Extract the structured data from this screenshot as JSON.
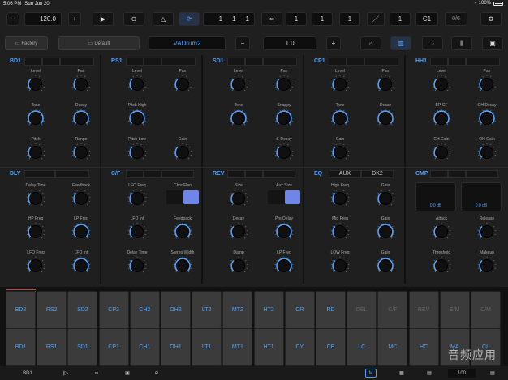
{
  "status": {
    "time": "5:06 PM",
    "date": "Sun Jun 20",
    "battery": "100%"
  },
  "toolbar": {
    "tempo": "120.0",
    "position": [
      "1",
      "1",
      "1"
    ],
    "loop_values": [
      "1",
      "1",
      "1"
    ],
    "step_value": "1",
    "note": "C1",
    "counter": "0/6"
  },
  "preset": {
    "bank": "Factory",
    "category": "Default",
    "name": "VADrum2",
    "value": "1.0"
  },
  "sections_top": [
    {
      "id": "BD1",
      "knobs": [
        "Level",
        "Pan",
        "Tone",
        "Decay",
        "Pitch",
        "Range"
      ]
    },
    {
      "id": "RS1",
      "knobs": [
        "Level",
        "Pan",
        "Pitch High",
        "",
        "Pitch Low",
        "Gain"
      ]
    },
    {
      "id": "SD1",
      "knobs": [
        "Level",
        "Pan",
        "Tone",
        "Snappy",
        "",
        "S-Decay"
      ]
    },
    {
      "id": "CP1",
      "knobs": [
        "Level",
        "Pan",
        "Tone",
        "Decay",
        "Gain",
        ""
      ]
    },
    {
      "id": "HH1",
      "knobs": [
        "Level",
        "Pan",
        "BP-CF",
        "OH Decay",
        "CH Gain",
        "OH Gain"
      ]
    }
  ],
  "sections_bottom": [
    {
      "id": "DLY",
      "knobs": [
        "Delay Time",
        "Feedback",
        "HP Freq",
        "LP Freq",
        "LFO Freq",
        "LFO Int"
      ]
    },
    {
      "id": "C/F",
      "knobs": [
        "LFO Freq",
        "Chor/Flan",
        "LFO Int",
        "Feedback",
        "Delay Time",
        "Stereo Width"
      ]
    },
    {
      "id": "REV",
      "knobs": [
        "Size",
        "Aux Size",
        "Decay",
        "Pre Delay",
        "Damp",
        "LP Freq"
      ]
    },
    {
      "id": "EQ",
      "tabs": [
        "AUX",
        "DK2"
      ],
      "knobs": [
        "High Freq",
        "Gain",
        "Mid Freq",
        "Gain",
        "LOW Freq",
        "Gain"
      ]
    },
    {
      "id": "CMP",
      "meters": [
        "0.0 dB",
        "0.0 dB"
      ],
      "knobs": [
        "Attack",
        "Release",
        "Threshold",
        "Makeup"
      ]
    }
  ],
  "pads_row1": [
    "BD2",
    "RS2",
    "SD2",
    "CP2",
    "CH2",
    "OH2",
    "LT2",
    "MT2",
    "HT2",
    "CR",
    "RD",
    "DEL",
    "C/F",
    "REV",
    "E/M",
    "C/M"
  ],
  "pads_row2": [
    "BD1",
    "RS1",
    "SD1",
    "CP1",
    "CH1",
    "OH1",
    "LT1",
    "MT1",
    "HT1",
    "CY",
    "CB",
    "LC",
    "MC",
    "HC",
    "MA",
    "CL"
  ],
  "pads_dim": [
    "DEL",
    "C/F",
    "REV",
    "E/M",
    "C/M"
  ],
  "bottom": {
    "track": "BD1",
    "volume": "100"
  },
  "watermark": "音频应用",
  "colors": {
    "accent": "#4ea3ff",
    "toggle": "#6f86e8"
  }
}
